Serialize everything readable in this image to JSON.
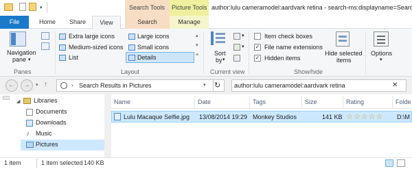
{
  "colors": {
    "file_tab": "#1979ca",
    "search_tools": "#f7ddc4",
    "picture_tools": "#efef9e",
    "selection": "#cce8ff",
    "selection_border": "#99d1ff"
  },
  "titlebar": {
    "title": "author:lulu cameramodel:aardvark retina - search-ms:displayname=Search",
    "context_search_tools": "Search Tools",
    "context_picture_tools": "Picture Tools"
  },
  "tabs": {
    "file": "File",
    "home": "Home",
    "share": "Share",
    "view": "View",
    "search": "Search",
    "manage": "Manage"
  },
  "ribbon": {
    "panes": {
      "navigation_pane": "Navigation",
      "navigation_pane_2": "pane",
      "label": "Panes"
    },
    "layout": {
      "extra_large": "Extra large icons",
      "large": "Large icons",
      "medium": "Medium-sized icons",
      "small": "Small icons",
      "list": "List",
      "details": "Details",
      "label": "Layout"
    },
    "current_view": {
      "sort_by": "Sort",
      "sort_by_2": "by",
      "label": "Current view"
    },
    "show_hide": {
      "item_check_boxes": "Item check boxes",
      "file_name_extensions": "File name extensions",
      "hidden_items": "Hidden items",
      "hide_selected": "Hide selected",
      "hide_selected_2": "items",
      "label": "Show/hide"
    },
    "options": {
      "label": "Options"
    },
    "checkbox_states": {
      "item_check_boxes": false,
      "file_name_extensions": true,
      "hidden_items": true
    }
  },
  "address": {
    "path": "Search Results in Pictures",
    "search_query": "author:lulu cameramodel:aardvark retina"
  },
  "nav": {
    "items": [
      {
        "label": "Libraries",
        "icon": "libraries-icon"
      },
      {
        "label": "Documents",
        "icon": "documents-icon"
      },
      {
        "label": "Downloads",
        "icon": "downloads-icon"
      },
      {
        "label": "Music",
        "icon": "music-icon"
      },
      {
        "label": "Pictures",
        "icon": "pictures-icon"
      }
    ]
  },
  "columns": [
    "Name",
    "Date",
    "Tags",
    "Size",
    "Rating",
    "Folde"
  ],
  "rows": [
    {
      "name": "Lulu Macaque Selfie.jpg",
      "date": "13/08/2014 19:29",
      "tags": "Monkey Studios",
      "size": "141 KB",
      "rating_stars": "☆☆☆☆☆",
      "folder": "D:\\M"
    }
  ],
  "status": {
    "count": "1 item",
    "selection": "1 item selected",
    "size": "140 KB"
  }
}
